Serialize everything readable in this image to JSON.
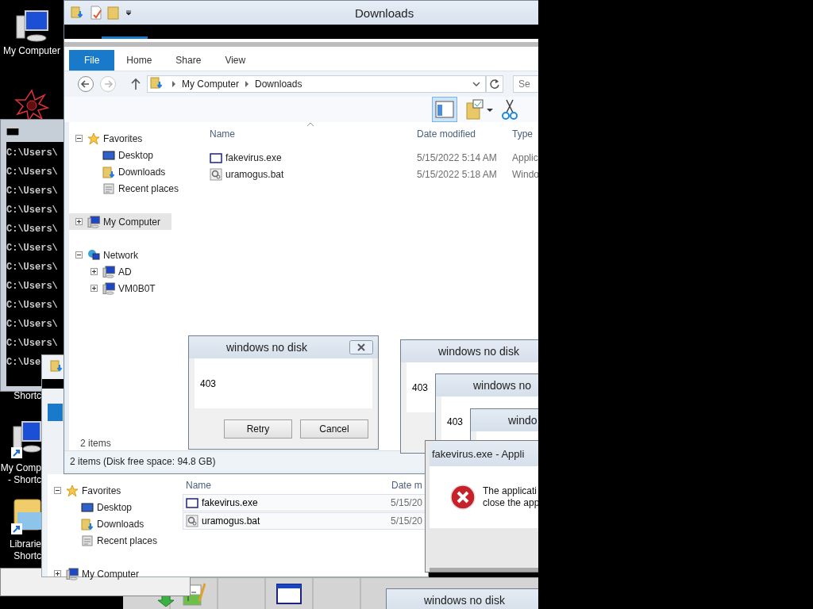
{
  "desktop_icons": [
    {
      "kind": "computer",
      "label_lines": [
        "My Computer"
      ]
    },
    {
      "kind": "starburst"
    },
    {
      "kind": "hidden",
      "label_lines": [
        "Shortc"
      ]
    },
    {
      "kind": "computer-shortcut",
      "label_lines": [
        "My Comp",
        "- Shortc"
      ]
    },
    {
      "kind": "library-shortcut",
      "label_lines": [
        "Librarie",
        "Shortc"
      ]
    }
  ],
  "console": {
    "lines": [
      "C:\\Users\\",
      "C:\\Users\\",
      "C:\\Users\\",
      "C:\\Users\\",
      "C:\\Users\\",
      "C:\\Users\\",
      "C:\\Users\\",
      "C:\\Users\\",
      "C:\\Users\\",
      "C:\\Users\\",
      "C:\\Users\\",
      "C:\\Use"
    ]
  },
  "back_explorer": {
    "nav_tree": [
      {
        "label": "Favorites",
        "kind": "star",
        "selected": false,
        "expanded": true,
        "children": [
          {
            "label": "Desktop",
            "kind": "desktop",
            "selected": false
          },
          {
            "label": "Downloads",
            "kind": "downloads",
            "selected": false
          },
          {
            "label": "Recent places",
            "kind": "recent",
            "selected": false
          }
        ]
      },
      {
        "label": "My Computer",
        "kind": "computer",
        "selected": false,
        "expanded": false
      }
    ],
    "columns": [
      "Name",
      "Date m"
    ],
    "rows": [
      {
        "name": "fakevirus.exe",
        "kind": "exe",
        "date": "5/15/20"
      },
      {
        "name": "uramogus.bat",
        "kind": "bat",
        "date": "5/15/20"
      }
    ]
  },
  "explorer": {
    "title": "Downloads",
    "ribbon_tabs": [
      {
        "label": "File",
        "kind": "file"
      },
      {
        "label": "Home",
        "kind": "tab"
      },
      {
        "label": "Share",
        "kind": "tab"
      },
      {
        "label": "View",
        "kind": "tab"
      }
    ],
    "breadcrumb": [
      "My Computer",
      "Downloads"
    ],
    "search_placeholder": "Se",
    "nav_tree": [
      {
        "label": "Favorites",
        "kind": "star",
        "selected": false,
        "expanded": true,
        "children": [
          {
            "label": "Desktop",
            "kind": "desktop",
            "selected": false
          },
          {
            "label": "Downloads",
            "kind": "downloads",
            "selected": false
          },
          {
            "label": "Recent places",
            "kind": "recent",
            "selected": false
          }
        ]
      },
      {
        "label": "My Computer",
        "kind": "computer",
        "selected": true,
        "expanded": false
      },
      {
        "label": "Network",
        "kind": "network",
        "selected": false,
        "expanded": true,
        "children": [
          {
            "label": "AD",
            "kind": "computer",
            "selected": false,
            "expanded": false
          },
          {
            "label": "VM0B0T",
            "kind": "computer",
            "selected": false,
            "expanded": false
          }
        ]
      }
    ],
    "columns": [
      "Name",
      "Date modified",
      "Type"
    ],
    "rows": [
      {
        "name": "fakevirus.exe",
        "kind": "exe",
        "date": "5/15/2022 5:14 AM",
        "type": "Applic"
      },
      {
        "name": "uramogus.bat",
        "kind": "bat",
        "date": "5/15/2022 5:18 AM",
        "type": "Windo"
      }
    ],
    "item_count": "2 items",
    "status": "2 items (Disk free space: 94.8 GB)"
  },
  "taskbar": [
    {
      "kind": "arrow"
    },
    {
      "kind": "notepad"
    },
    {
      "kind": "blank"
    },
    {
      "kind": "window"
    },
    {
      "kind": "blank"
    }
  ],
  "dialogs": [
    {
      "title": "windows no disk",
      "close_button": true,
      "message": "403",
      "buttons": [
        "Retry",
        "Cancel"
      ]
    },
    {
      "title": "windows no disk",
      "message": "403"
    },
    {
      "title": "windows no",
      "message": "403"
    },
    {
      "title": "windo"
    },
    {
      "title": "windows no disk"
    }
  ],
  "error_dialog": {
    "title": "fakevirus.exe - Appli",
    "message_lines": [
      "The applicati",
      "close the app"
    ]
  }
}
